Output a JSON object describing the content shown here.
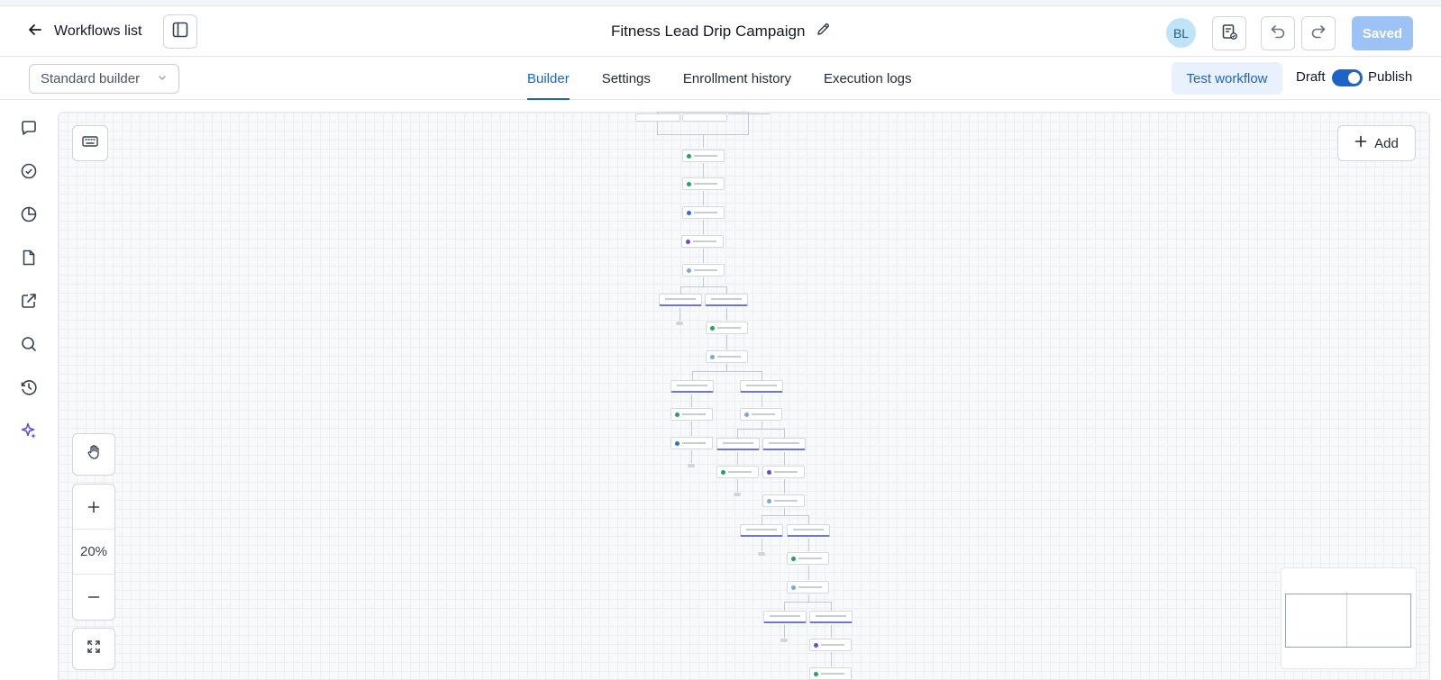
{
  "header": {
    "back_label": "Workflows list",
    "title": "Fitness Lead Drip Campaign",
    "avatar_initials": "BL",
    "saved_label": "Saved"
  },
  "subheader": {
    "builder_select": "Standard builder",
    "tabs": [
      {
        "label": "Builder",
        "active": true
      },
      {
        "label": "Settings",
        "active": false
      },
      {
        "label": "Enrollment history",
        "active": false
      },
      {
        "label": "Execution logs",
        "active": false
      }
    ],
    "test_label": "Test workflow",
    "draft_label": "Draft",
    "publish_label": "Publish",
    "published": true
  },
  "sidebar": {
    "icons": [
      "chat-icon",
      "check-circle-icon",
      "pie-chart-icon",
      "document-icon",
      "external-link-icon",
      "search-icon",
      "clock-history-icon",
      "sparkle-icon"
    ]
  },
  "canvas": {
    "add_label": "Add",
    "zoom_level": "20%",
    "accent": "#1d64c8",
    "branch_accent": "#6f78c4"
  }
}
